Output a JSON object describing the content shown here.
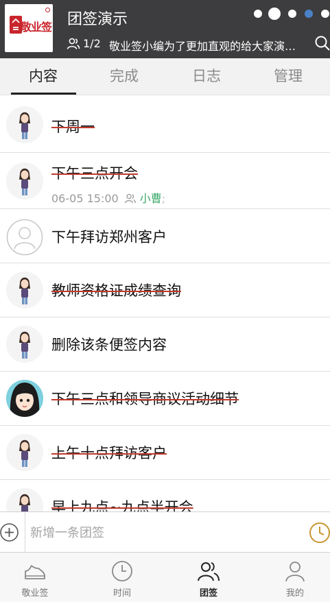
{
  "header": {
    "logo_text": "敬业签",
    "title": "团签演示",
    "members_count": "1/2",
    "description": "敬业签小编为了更加直观的给大家演示…",
    "search_icon": "search-icon",
    "members_icon": "people-icon"
  },
  "tabs": [
    {
      "label": "内容"
    },
    {
      "label": "完成"
    },
    {
      "label": "日志"
    },
    {
      "label": "管理"
    }
  ],
  "notes": [
    {
      "text": "下周一",
      "done": true,
      "avatar": "girl-avatar"
    },
    {
      "text": "下午三点开会",
      "done": true,
      "avatar": "girl-avatar",
      "time": "06-05 15:00",
      "person": "小曹",
      "sep": ";"
    },
    {
      "text": "下午拜访郑州客户",
      "done": false,
      "avatar": "default-avatar"
    },
    {
      "text": "教师资格证成绩查询",
      "done": true,
      "avatar": "girl-avatar"
    },
    {
      "text": "删除该条便签内容",
      "done": false,
      "avatar": "girl-avatar"
    },
    {
      "text": "下午三点和领导商议活动细节",
      "done": true,
      "avatar": "cartoon-avatar"
    },
    {
      "text": "上午十点拜访客户",
      "done": true,
      "avatar": "girl-avatar"
    },
    {
      "text": "早上九点~九点半开会",
      "done": true,
      "avatar": "girl-avatar"
    }
  ],
  "add_bar": {
    "placeholder": "新增一条团签",
    "add_icon": "plus-circle-icon",
    "clock_icon": "clock-icon"
  },
  "bottom_nav": [
    {
      "label": "敬业签",
      "icon": "shoe-icon",
      "active": false
    },
    {
      "label": "时间",
      "icon": "clock-icon",
      "active": false
    },
    {
      "label": "团签",
      "icon": "group-icon",
      "active": true
    },
    {
      "label": "我的",
      "icon": "person-icon",
      "active": false
    }
  ],
  "colors": {
    "header_bg": "#3d3d3f",
    "accent_blue": "#4a82c8",
    "strike_red": "#c0392b",
    "person_green": "#3aa86a",
    "clock_gold": "#c89632"
  }
}
